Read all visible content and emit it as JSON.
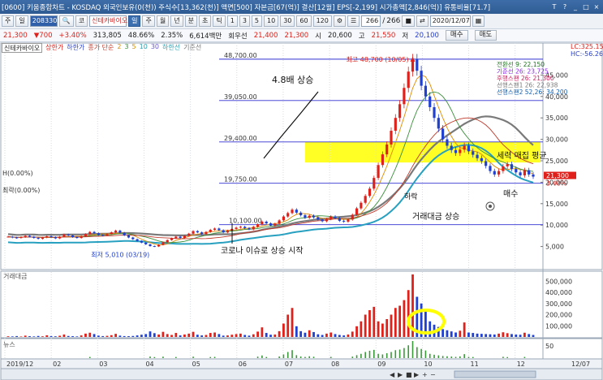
{
  "title_bar": {
    "text": "[0600] 키움종합차트 - KOSDAQ 외국인보유(0(천)) 주식수[13,362(천)] 액면[500] 자본금[67(억)] 결산[12월] EPS[-2,199] 시가총액[2,846(억)] 유통비율[71.7]",
    "window_buttons": [
      "T",
      "?",
      "_",
      "□",
      "×"
    ]
  },
  "toolbar": {
    "menu1": "주",
    "menu2": "일",
    "code": "208330",
    "search_icon": "search-icon",
    "stock_name_prefix": "코",
    "stock_name": "신테카바이오",
    "period_buttons": [
      "일",
      "주",
      "월",
      "년",
      "분",
      "초",
      "틱"
    ],
    "selected_period": "일",
    "minute_options": [
      "1",
      "3",
      "5",
      "10",
      "30",
      "60",
      "120"
    ],
    "count": "266",
    "count_total": "266",
    "date": "2020/12/07"
  },
  "price_bar": {
    "price": "21,300",
    "change": "▼700",
    "change_pct": "+3.40%",
    "volume": "313,805",
    "ratio1": "48.66%",
    "ratio2": "2.35%",
    "amount": "6,614백만",
    "pref": "회우선",
    "v1": "21,400",
    "v2": "21,300",
    "open_label": "시",
    "open": "20,600",
    "high_label": "고",
    "high": "21,550",
    "low_label": "저",
    "low": "20,100",
    "buy": "매수",
    "sell": "매도"
  },
  "legend": {
    "name": "신테카바이오",
    "upper": "상한가",
    "lower": "하한가",
    "ma_label": "종가 단순",
    "ma_values": [
      "2",
      "3",
      "5",
      "10",
      "30"
    ],
    "ma_tail": "하한선",
    "std_label": "기준선"
  },
  "right_tags": {
    "lc": "LC:325.15",
    "hc": "HC:-56.26"
  },
  "chart_data": {
    "type": "line",
    "price_levels": [
      {
        "label": "48,700.00",
        "value": 48700
      },
      {
        "label": "39,050.00",
        "value": 39050
      },
      {
        "label": "29,400.00",
        "value": 29400
      },
      {
        "label": "19,750.00",
        "value": 19750
      },
      {
        "label": "10,100.00",
        "value": 10100
      }
    ],
    "yticks": [
      "45,000",
      "40,000",
      "35,000",
      "30,000",
      "25,000",
      "20,000",
      "15,000",
      "10,000",
      "5,000"
    ],
    "ytick_values": [
      45000,
      40000,
      35000,
      30000,
      25000,
      20000,
      15000,
      10000,
      5000
    ],
    "ylim": [
      0,
      50000
    ],
    "xticks": [
      "2019/12",
      "02",
      "03",
      "04",
      "05",
      "06",
      "07",
      "08",
      "09",
      "10",
      "11",
      "12"
    ],
    "high_label": "최고 48,700 (10/05)",
    "low_label": "최저 5,010 (03/19)",
    "current_tag": "21,300",
    "current_tag2": "3.40%",
    "pct_left1": "0.00%",
    "pct_left2": "0.00%",
    "ichimoku": [
      {
        "label": "전환선 9: 22,150"
      },
      {
        "label": "기준선 26: 23,725"
      },
      {
        "label": "후행스팬 26: 21,300"
      },
      {
        "label": "선행스팬1 26: 22,938"
      },
      {
        "label": "선행스팬2 52,26: 34,200"
      }
    ],
    "annotations": [
      "4.8배 상승",
      "세력 매집 평균",
      "하락",
      "거래대금 상승",
      "매수",
      "코로나 이슈로 상승 시작"
    ],
    "close": [
      7300,
      7100,
      7000,
      7200,
      7500,
      7300,
      7000,
      6800,
      7100,
      7400,
      7200,
      6900,
      7300,
      7800,
      7600,
      7200,
      7000,
      7400,
      7900,
      8400,
      8100,
      7700,
      7600,
      7900,
      8300,
      8700,
      8200,
      7600,
      7100,
      6700,
      6300,
      5900,
      5500,
      5100,
      5010,
      5400,
      6000,
      6500,
      6900,
      7300,
      7000,
      7500,
      8000,
      8600,
      8300,
      7900,
      8400,
      8900,
      9200,
      8800,
      8300,
      8700,
      9100,
      9400,
      9600,
      9300,
      9000,
      9600,
      10200,
      10800,
      10400,
      9900,
      10300,
      11100,
      12000,
      12800,
      13600,
      12900,
      12300,
      11700,
      12200,
      11800,
      11300,
      10900,
      11400,
      12000,
      11600,
      11000,
      10800,
      11300,
      12400,
      13900,
      15200,
      16800,
      18500,
      21000,
      24000,
      26500,
      28800,
      32000,
      35000,
      38200,
      42000,
      45800,
      48700,
      46000,
      42500,
      40000,
      37500,
      35000,
      32500,
      30000,
      28500,
      27500,
      26800,
      27600,
      28500,
      27200,
      26400,
      25600,
      24900,
      23800,
      22600,
      21800,
      22600,
      23700,
      24200,
      23100,
      22300,
      21600,
      22800,
      21800,
      21300
    ],
    "volume_label": "거래대금",
    "volume_ticks": [
      "500,000",
      "400,000",
      "300,000",
      "200,000",
      "100,000"
    ],
    "volume_tick_values": [
      500000,
      400000,
      300000,
      200000,
      100000
    ],
    "volume_ylim": [
      0,
      560000
    ],
    "volume": [
      6000,
      5000,
      8000,
      4000,
      12000,
      7000,
      5000,
      9000,
      6000,
      15000,
      8000,
      6000,
      11000,
      22000,
      9000,
      7000,
      5000,
      14000,
      30000,
      38000,
      26000,
      12000,
      8000,
      10000,
      16000,
      28000,
      12000,
      8000,
      7000,
      9000,
      14000,
      20000,
      26000,
      50000,
      34000,
      22000,
      46000,
      26000,
      18000,
      36000,
      14000,
      22000,
      30000,
      46000,
      20000,
      14000,
      18000,
      36000,
      40000,
      26000,
      12000,
      14000,
      20000,
      26000,
      30000,
      18000,
      12000,
      24000,
      48000,
      86000,
      36000,
      20000,
      22000,
      52000,
      120000,
      200000,
      260000,
      96000,
      52000,
      38000,
      60000,
      44000,
      24000,
      18000,
      30000,
      40000,
      26000,
      18000,
      14000,
      22000,
      48000,
      96000,
      140000,
      200000,
      240000,
      270000,
      140000,
      120000,
      160000,
      200000,
      260000,
      280000,
      330000,
      420000,
      560000,
      360000,
      300000,
      250000,
      140000,
      110000,
      90000,
      70000,
      60000,
      50000,
      40000,
      56000,
      130000,
      40000,
      36000,
      30000,
      28000,
      26000,
      24000,
      22000,
      30000,
      42000,
      34000,
      26000,
      22000,
      20000,
      38000,
      26000,
      18000
    ],
    "news_label": "뉴스",
    "news_tick": "50",
    "news_tick_value": 50,
    "news_ylim": [
      0,
      80
    ],
    "footer_right": "12/07"
  }
}
